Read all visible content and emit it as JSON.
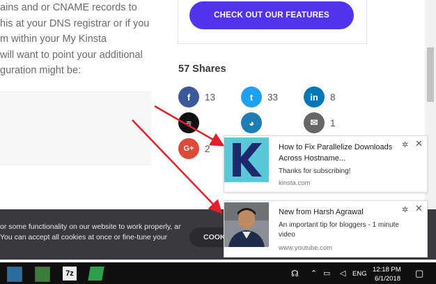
{
  "article": {
    "lines": [
      "ains and or CNAME records to",
      "his at your DNS registrar or if you",
      "m within your My Kinsta",
      "will want to point your additional",
      "guration might be:"
    ]
  },
  "cta": {
    "label": "CHECK OUT OUR FEATURES"
  },
  "shares": {
    "title": "57 Shares",
    "items": [
      {
        "network": "facebook",
        "icon": "f",
        "count": "13",
        "color": "#3b5998"
      },
      {
        "network": "twitter",
        "icon": "t",
        "count": "33",
        "color": "#1da1f2"
      },
      {
        "network": "linkedin",
        "icon": "in",
        "count": "8",
        "color": "#0077b5"
      },
      {
        "network": "buffer",
        "icon": "≡",
        "count": "",
        "color": "#111111"
      },
      {
        "network": "hootsuite",
        "icon": "◕",
        "count": "",
        "color": "#1f7db5"
      },
      {
        "network": "email",
        "icon": "✉",
        "count": "1",
        "color": "#666666"
      },
      {
        "network": "google-plus",
        "icon": "G+",
        "count": "2",
        "color": "#dc4a38"
      }
    ]
  },
  "cookie": {
    "lines": [
      "or some functionality on our website to work properly, and",
      "You can accept all cookies at once or fine-tune your"
    ],
    "button": "COOKI"
  },
  "notifications": [
    {
      "title": "How to Fix Parallelize Downloads Across Hostname...",
      "body": "Thanks for subscribing!",
      "source": "kinsta.com"
    },
    {
      "title": "New from Harsh Agrawal",
      "body": "An important tip for bloggers - 1 minute video",
      "source": "www.youtube.com"
    }
  ],
  "taskbar": {
    "language": "ENG",
    "time": "12:18 PM",
    "date": "6/1/2018",
    "sevenzip_label": "7z"
  },
  "colors": {
    "brand_purple": "#5333ed",
    "kinsta_teal": "#5ac8d8",
    "kinsta_navy": "#1a2a6c",
    "arrow_red": "#e0202a"
  }
}
